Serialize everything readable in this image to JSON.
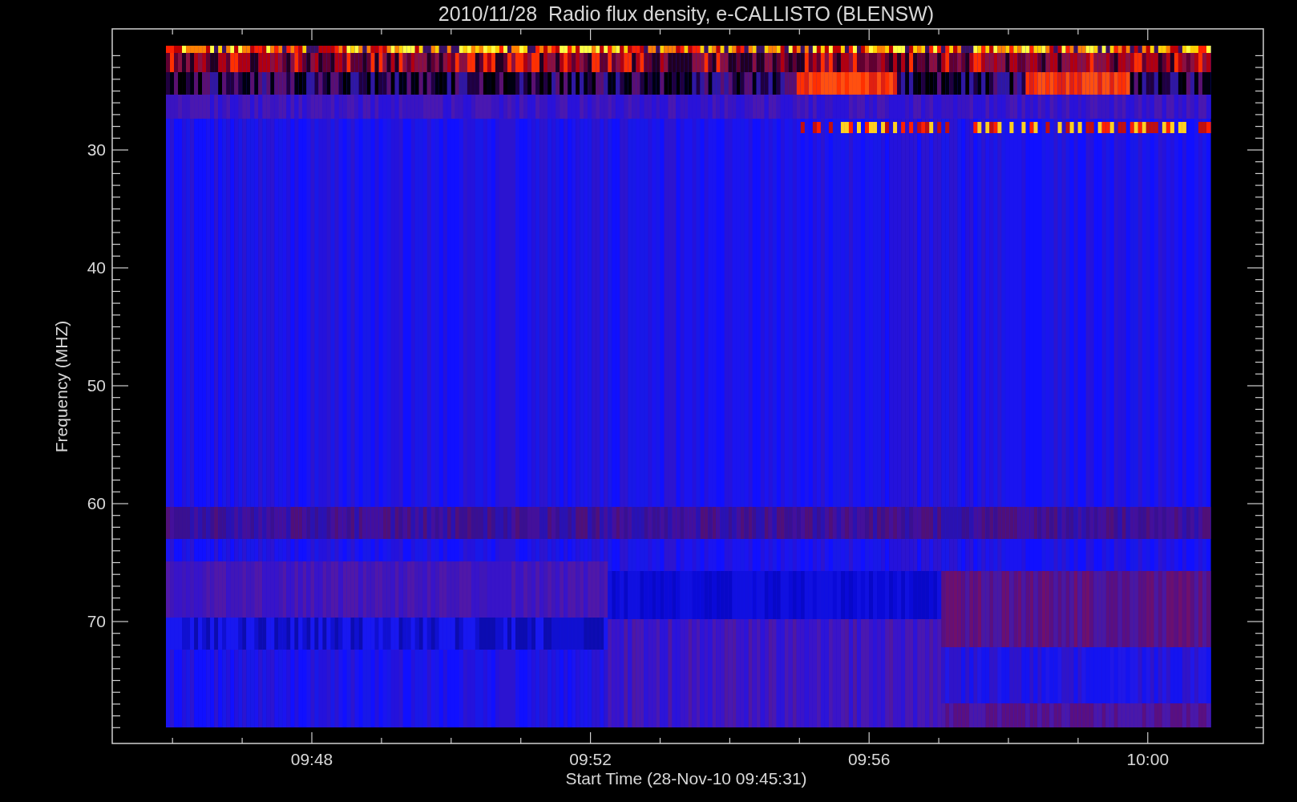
{
  "title": "2010/11/28  Radio flux density, e-CALLISTO (BLENSW)",
  "y_axis": {
    "label": "Frequency (MHZ)",
    "ticks": [
      "30",
      "40",
      "50",
      "60",
      "70"
    ]
  },
  "x_axis": {
    "label": "Start Time (28-Nov-10 09:45:31)",
    "ticks": [
      "09:48",
      "09:52",
      "09:56",
      "10:00"
    ]
  }
}
